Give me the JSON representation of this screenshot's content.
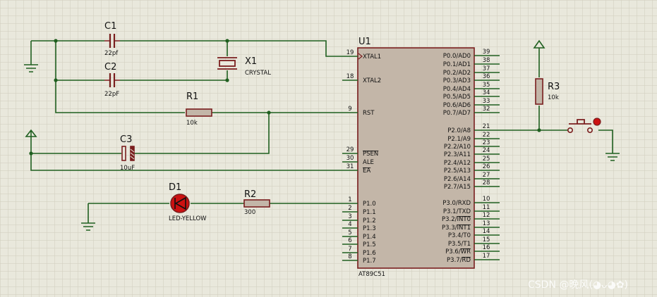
{
  "components": {
    "c1": {
      "ref": "C1",
      "value": "22pf"
    },
    "c2": {
      "ref": "C2",
      "value": "22pF"
    },
    "x1": {
      "ref": "X1",
      "value": "CRYSTAL"
    },
    "r1": {
      "ref": "R1",
      "value": "10k"
    },
    "c3": {
      "ref": "C3",
      "value": "10uF"
    },
    "d1": {
      "ref": "D1",
      "value": "LED-YELLOW"
    },
    "r2": {
      "ref": "R2",
      "value": "300"
    },
    "r3": {
      "ref": "R3",
      "value": "10k"
    },
    "u1": {
      "ref": "U1",
      "part": "AT89C51"
    }
  },
  "left_pins": [
    {
      "num": "19",
      "name": "XTAL1"
    },
    {
      "num": "18",
      "name": "XTAL2"
    },
    {
      "num": "9",
      "name": "RST"
    },
    {
      "num": "29",
      "name": "PSEN"
    },
    {
      "num": "30",
      "name": "ALE"
    },
    {
      "num": "31",
      "name": "EA"
    },
    {
      "num": "1",
      "name": "P1.0"
    },
    {
      "num": "2",
      "name": "P1.1"
    },
    {
      "num": "3",
      "name": "P1.2"
    },
    {
      "num": "4",
      "name": "P1.3"
    },
    {
      "num": "5",
      "name": "P1.4"
    },
    {
      "num": "6",
      "name": "P1.5"
    },
    {
      "num": "7",
      "name": "P1.6"
    },
    {
      "num": "8",
      "name": "P1.7"
    }
  ],
  "right_pins": [
    {
      "num": "39",
      "name": "P0.0/AD0"
    },
    {
      "num": "38",
      "name": "P0.1/AD1"
    },
    {
      "num": "37",
      "name": "P0.2/AD2"
    },
    {
      "num": "36",
      "name": "P0.3/AD3"
    },
    {
      "num": "35",
      "name": "P0.4/AD4"
    },
    {
      "num": "34",
      "name": "P0.5/AD5"
    },
    {
      "num": "33",
      "name": "P0.6/AD6"
    },
    {
      "num": "32",
      "name": "P0.7/AD7"
    },
    {
      "num": "21",
      "name": "P2.0/A8"
    },
    {
      "num": "22",
      "name": "P2.1/A9"
    },
    {
      "num": "23",
      "name": "P2.2/A10"
    },
    {
      "num": "24",
      "name": "P2.3/A11"
    },
    {
      "num": "25",
      "name": "P2.4/A12"
    },
    {
      "num": "26",
      "name": "P2.5/A13"
    },
    {
      "num": "27",
      "name": "P2.6/A14"
    },
    {
      "num": "28",
      "name": "P2.7/A15"
    },
    {
      "num": "10",
      "name": "P3.0/RXD"
    },
    {
      "num": "11",
      "name": "P3.1/TXD"
    },
    {
      "num": "12",
      "name": "P3.2/INT0"
    },
    {
      "num": "13",
      "name": "P3.3/INT1"
    },
    {
      "num": "14",
      "name": "P3.4/T0"
    },
    {
      "num": "15",
      "name": "P3.5/T1"
    },
    {
      "num": "16",
      "name": "P3.6/WR"
    },
    {
      "num": "17",
      "name": "P3.7/RD"
    }
  ],
  "watermark": "CSDN @晚风(◕ᴗ◕✿)",
  "colors": {
    "background": "#e9e8dc",
    "grid": "#cfcdbd",
    "wire": "#1f5f1f",
    "component": "#7a1e1e",
    "chip_fill": "#c3b6a8",
    "led": "#cc1111"
  }
}
